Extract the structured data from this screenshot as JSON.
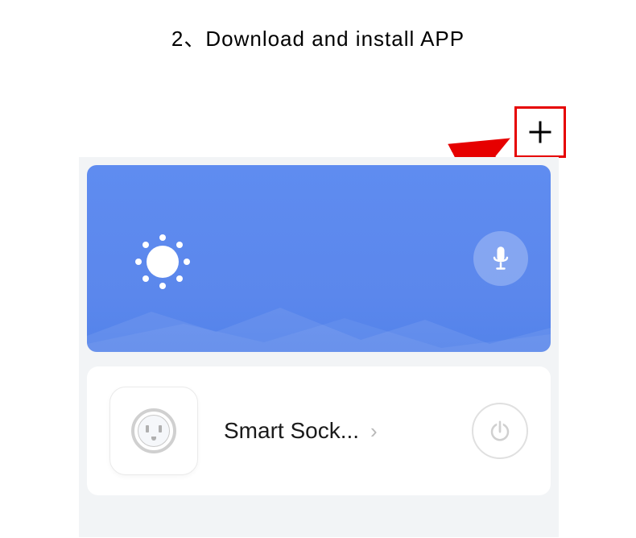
{
  "title": "2、Download and install APP",
  "callout": {
    "highlight_color": "#e60000"
  },
  "app": {
    "header": {
      "bg_color": "#5c88ed"
    },
    "device": {
      "name": "Smart Sock..."
    }
  }
}
